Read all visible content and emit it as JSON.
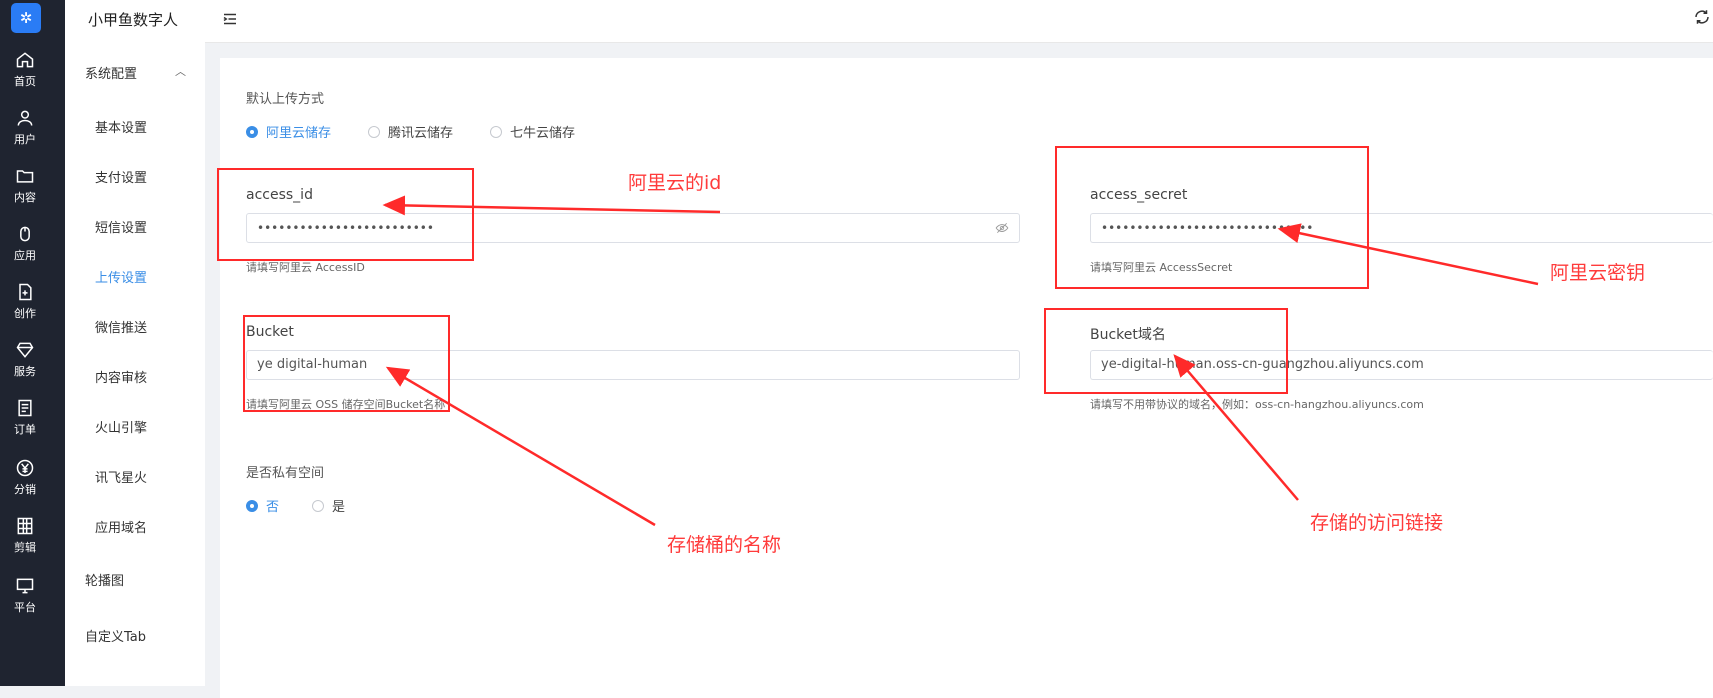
{
  "app": {
    "name": "小甲鱼数字人"
  },
  "rail": [
    {
      "label": "首页",
      "icon": "home-icon"
    },
    {
      "label": "用户",
      "icon": "user-icon"
    },
    {
      "label": "内容",
      "icon": "folder-icon"
    },
    {
      "label": "应用",
      "icon": "mouse-icon"
    },
    {
      "label": "创作",
      "icon": "file-plus-icon"
    },
    {
      "label": "服务",
      "icon": "diamond-icon"
    },
    {
      "label": "订单",
      "icon": "order-list-icon"
    },
    {
      "label": "分销",
      "icon": "yen-icon"
    },
    {
      "label": "剪辑",
      "icon": "film-grid-icon"
    },
    {
      "label": "平台",
      "icon": "monitor-icon"
    }
  ],
  "subnav": {
    "group": "系统配置",
    "items": [
      "基本设置",
      "支付设置",
      "短信设置",
      "上传设置",
      "微信推送",
      "内容审核",
      "火山引擎",
      "讯飞星火",
      "应用域名"
    ],
    "active": "上传设置",
    "extra": [
      "轮播图",
      "自定义Tab"
    ]
  },
  "form": {
    "upload_label": "默认上传方式",
    "upload_options": [
      "阿里云储存",
      "腾讯云储存",
      "七牛云储存"
    ],
    "upload_selected": "阿里云储存",
    "access_id": {
      "label": "access_id",
      "value": "•••••••••••••••••••••••••",
      "hint": "请填写阿里云 AccessID"
    },
    "access_secret": {
      "label": "access_secret",
      "value": "••••••••••••••••••••••••••••••",
      "hint": "请填写阿里云 AccessSecret"
    },
    "bucket": {
      "label": "Bucket",
      "value": "ye digital-human",
      "hint": "请填写阿里云 OSS 储存空间Bucket名称"
    },
    "bucket_domain": {
      "label": "Bucket域名",
      "value": "ye-digital-human.oss-cn-guangzhou.aliyuncs.com",
      "hint": "请填写不用带协议的域名，例如：oss-cn-hangzhou.aliyuncs.com"
    },
    "private_label": "是否私有空间",
    "private_options": [
      "否",
      "是"
    ],
    "private_selected": "否"
  },
  "annotations": {
    "access_id_note": "阿里云的id",
    "secret_note": "阿里云密钥",
    "bucket_note": "存储桶的名称",
    "domain_note": "存储的访问链接",
    "color": "#ff2a2a"
  }
}
